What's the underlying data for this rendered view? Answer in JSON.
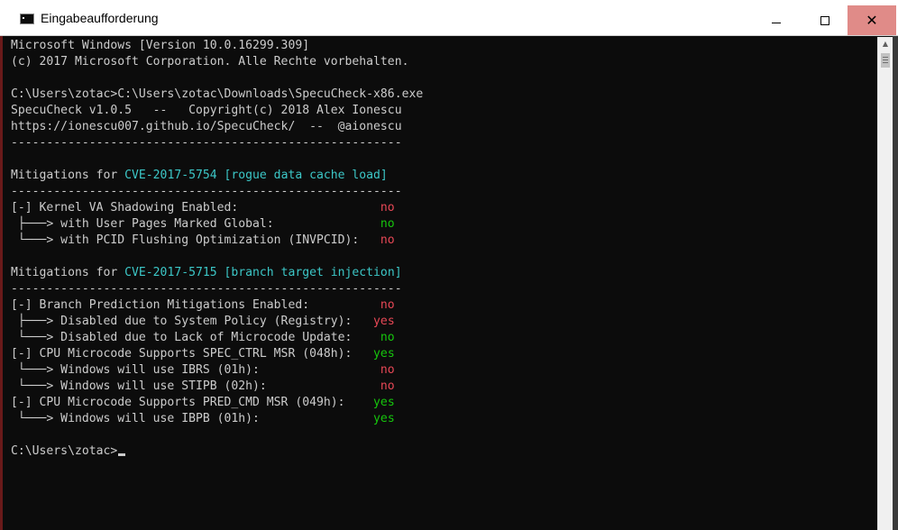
{
  "window": {
    "title": "Eingabeaufforderung",
    "controls": {
      "minimize": "–",
      "maximize": "☐",
      "close": "✕"
    }
  },
  "console": {
    "lines": [
      [
        {
          "t": "Microsoft Windows [Version 10.0.16299.309]"
        }
      ],
      [
        {
          "t": "(c) 2017 Microsoft Corporation. Alle Rechte vorbehalten."
        }
      ],
      [
        {
          "t": ""
        }
      ],
      [
        {
          "t": "C:\\Users\\zotac>C:\\Users\\zotac\\Downloads\\SpecuCheck-x86.exe"
        }
      ],
      [
        {
          "t": "SpecuCheck v1.0.5   --   Copyright(c) 2018 Alex Ionescu"
        }
      ],
      [
        {
          "t": "https://ionescu007.github.io/SpecuCheck/  --  @aionescu"
        }
      ],
      [
        {
          "t": "-------------------------------------------------------"
        }
      ],
      [
        {
          "t": ""
        }
      ],
      [
        {
          "t": "Mitigations for "
        },
        {
          "t": "CVE-2017-5754 [rogue data cache load]",
          "c": "cyan"
        }
      ],
      [
        {
          "t": "-------------------------------------------------------"
        }
      ],
      [
        {
          "t": "[-] Kernel VA Shadowing Enabled:                    "
        },
        {
          "t": "no",
          "c": "red"
        }
      ],
      [
        {
          "t": " ├───> with User Pages Marked Global:               "
        },
        {
          "t": "no",
          "c": "green"
        }
      ],
      [
        {
          "t": " └───> with PCID Flushing Optimization (INVPCID):   "
        },
        {
          "t": "no",
          "c": "red"
        }
      ],
      [
        {
          "t": ""
        }
      ],
      [
        {
          "t": "Mitigations for "
        },
        {
          "t": "CVE-2017-5715 [branch target injection]",
          "c": "cyan"
        }
      ],
      [
        {
          "t": "-------------------------------------------------------"
        }
      ],
      [
        {
          "t": "[-] Branch Prediction Mitigations Enabled:          "
        },
        {
          "t": "no",
          "c": "red"
        }
      ],
      [
        {
          "t": " ├───> Disabled due to System Policy (Registry):   "
        },
        {
          "t": "yes",
          "c": "red"
        }
      ],
      [
        {
          "t": " └───> Disabled due to Lack of Microcode Update:    "
        },
        {
          "t": "no",
          "c": "green"
        }
      ],
      [
        {
          "t": "[-] CPU Microcode Supports SPEC_CTRL MSR (048h):   "
        },
        {
          "t": "yes",
          "c": "green"
        }
      ],
      [
        {
          "t": " └───> Windows will use IBRS (01h):                 "
        },
        {
          "t": "no",
          "c": "red"
        }
      ],
      [
        {
          "t": " └───> Windows will use STIPB (02h):                "
        },
        {
          "t": "no",
          "c": "red"
        }
      ],
      [
        {
          "t": "[-] CPU Microcode Supports PRED_CMD MSR (049h):    "
        },
        {
          "t": "yes",
          "c": "green"
        }
      ],
      [
        {
          "t": " └───> Windows will use IBPB (01h):                "
        },
        {
          "t": "yes",
          "c": "green"
        }
      ],
      [
        {
          "t": ""
        }
      ],
      [
        {
          "t": "C:\\Users\\zotac>"
        }
      ]
    ]
  }
}
